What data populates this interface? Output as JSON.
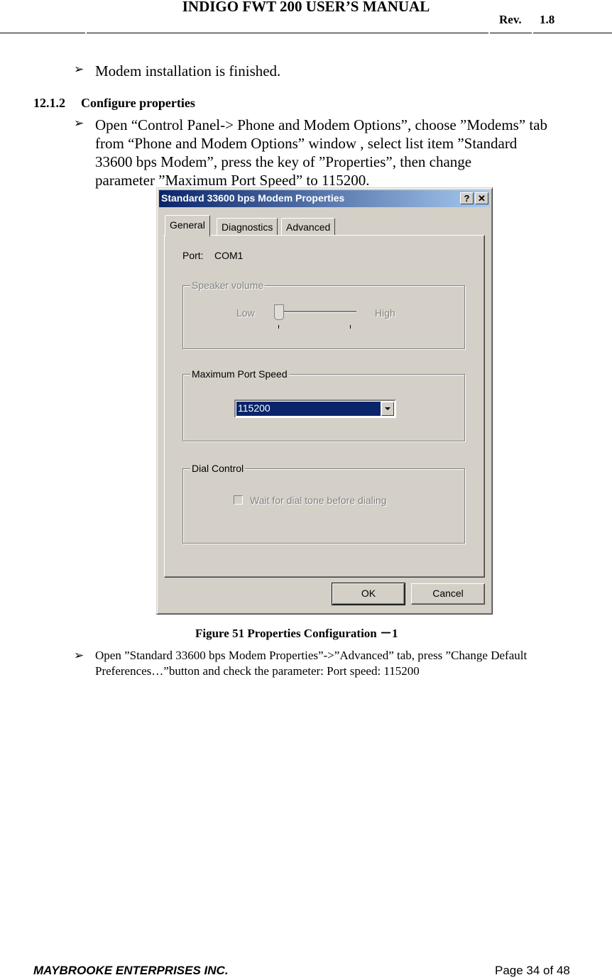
{
  "header": {
    "title": "INDIGO FWT 200 USER’S MANUAL",
    "rev_label": "Rev.",
    "rev_value": "1.8"
  },
  "content": {
    "bullet1": "Modem installation is finished.",
    "section_number": "12.1.2",
    "section_title": "Configure properties",
    "bullet2_lines": [
      "Open “Control Panel-> Phone and Modem Options”, choose ”Modems” tab",
      "from “Phone and Modem Options” window , select list item ”Standard",
      "33600 bps Modem”, press the key of ”Properties”, then change",
      "parameter ”Maximum Port Speed” to 115200."
    ],
    "figure_caption": "Figure 51 Properties Configuration －1",
    "bullet3_lines": [
      "Open ”Standard 33600 bps Modem Properties”->”Advanced” tab, press ”Change Default",
      "Preferences…”button and check the parameter: Port speed: 115200"
    ]
  },
  "dialog": {
    "title": "Standard 33600 bps Modem Properties",
    "help_icon": "?",
    "close_icon": "✕",
    "tabs": [
      {
        "label": "General",
        "active": true
      },
      {
        "label": "Diagnostics",
        "active": false
      },
      {
        "label": "Advanced",
        "active": false
      }
    ],
    "port_label": "Port:",
    "port_value": "COM1",
    "speaker_group": "Speaker volume",
    "speaker_low": "Low",
    "speaker_high": "High",
    "speaker_level": 0,
    "speed_group": "Maximum Port Speed",
    "speed_value": "115200",
    "dial_group": "Dial Control",
    "dial_checkbox_label": "Wait for dial tone before dialing",
    "dial_checkbox_checked": false,
    "ok_label": "OK",
    "cancel_label": "Cancel"
  },
  "footer": {
    "company": "MAYBROOKE ENTERPRISES INC.",
    "page": "Page 34 of 48"
  }
}
